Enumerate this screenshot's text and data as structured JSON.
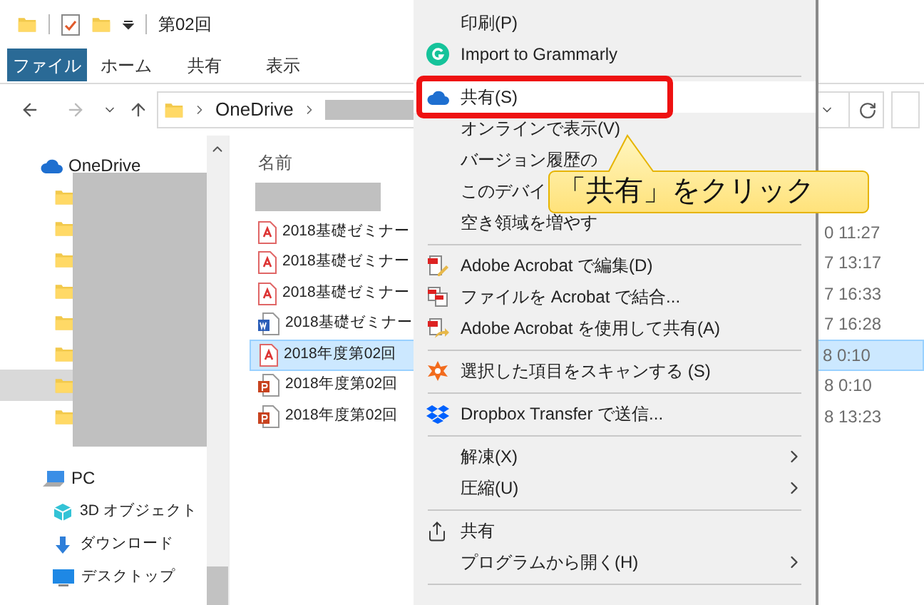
{
  "window": {
    "title": "第02回"
  },
  "ribbon_tabs": [
    {
      "label": "ファイル",
      "selected": true
    },
    {
      "label": "ホーム",
      "selected": false
    },
    {
      "label": "共有",
      "selected": false
    },
    {
      "label": "表示",
      "selected": false
    }
  ],
  "address_bar": {
    "path": [
      "OneDrive"
    ]
  },
  "navigation": {
    "onedrive": "OneDrive",
    "folders": [
      {
        "selected": false
      },
      {
        "selected": false
      },
      {
        "selected": false
      },
      {
        "selected": false
      },
      {
        "selected": false
      },
      {
        "selected": false
      },
      {
        "selected": true
      },
      {
        "selected": false
      }
    ],
    "pc": "PC",
    "pc_items": [
      "3D オブジェクト",
      "ダウンロード",
      "デスクトップ"
    ]
  },
  "file_list": {
    "column_1": "名前",
    "files": [
      {
        "kind": "pdf",
        "name": "2018基礎ゼミナー",
        "date": "0 11:27",
        "selected": false
      },
      {
        "kind": "pdf",
        "name": "2018基礎ゼミナー",
        "date": "7 13:17",
        "selected": false
      },
      {
        "kind": "pdf",
        "name": "2018基礎ゼミナー",
        "date": "7 16:33",
        "selected": false
      },
      {
        "kind": "word",
        "name": "2018基礎ゼミナー",
        "date": "7 16:28",
        "selected": false
      },
      {
        "kind": "pdf",
        "name": "2018年度第02回",
        "date": "8 0:10",
        "selected": true
      },
      {
        "kind": "powerpoint",
        "name": "2018年度第02回",
        "date": "8 0:10",
        "selected": false
      },
      {
        "kind": "powerpoint",
        "name": "2018年度第02回",
        "date": "8 13:23",
        "selected": false
      }
    ]
  },
  "context_menu": [
    {
      "kind": "item",
      "label": "印刷(P)",
      "selected": false,
      "submenu": false
    },
    {
      "kind": "item",
      "label": "Import to Grammarly",
      "selected": false,
      "submenu": false
    },
    {
      "kind": "separator"
    },
    {
      "kind": "item",
      "label": "共有(S)",
      "selected": true,
      "submenu": false
    },
    {
      "kind": "item",
      "label": "オンラインで表示(V)",
      "selected": false,
      "submenu": false
    },
    {
      "kind": "item",
      "label": "バージョン履歴の",
      "selected": false,
      "submenu": false
    },
    {
      "kind": "item",
      "label": "このデバイ",
      "selected": false,
      "submenu": false
    },
    {
      "kind": "item",
      "label": "空き領域を増やす",
      "selected": false,
      "submenu": false
    },
    {
      "kind": "separator"
    },
    {
      "kind": "item",
      "label": "Adobe Acrobat で編集(D)",
      "selected": false,
      "submenu": false
    },
    {
      "kind": "item",
      "label": "ファイルを Acrobat で結合...",
      "selected": false,
      "submenu": false
    },
    {
      "kind": "item",
      "label": "Adobe Acrobat を使用して共有(A)",
      "selected": false,
      "submenu": false
    },
    {
      "kind": "separator"
    },
    {
      "kind": "item",
      "label": "選択した項目をスキャンする (S)",
      "selected": false,
      "submenu": false
    },
    {
      "kind": "separator"
    },
    {
      "kind": "item",
      "label": "Dropbox Transfer で送信...",
      "selected": false,
      "submenu": false
    },
    {
      "kind": "separator"
    },
    {
      "kind": "item",
      "label": "解凍(X)",
      "selected": false,
      "submenu": true
    },
    {
      "kind": "item",
      "label": "圧縮(U)",
      "selected": false,
      "submenu": true
    },
    {
      "kind": "separator"
    },
    {
      "kind": "item",
      "label": "共有",
      "selected": false,
      "submenu": false
    },
    {
      "kind": "item",
      "label": "プログラムから開く(H)",
      "selected": false,
      "submenu": true
    },
    {
      "kind": "separator"
    }
  ],
  "callout": {
    "text": "「共有」をクリック"
  }
}
